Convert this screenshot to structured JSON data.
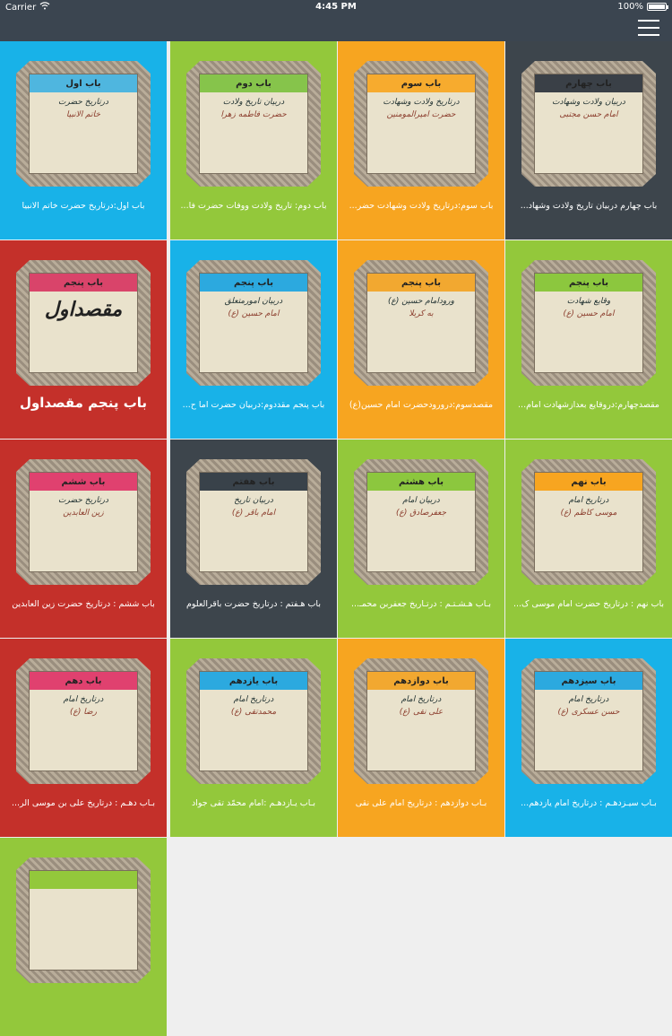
{
  "status": {
    "carrier": "Carrier",
    "time": "4:45 PM",
    "battery": "100%"
  },
  "colors": {
    "blue": "#18b2e8",
    "green": "#93c83b",
    "orange": "#f7a520",
    "dark": "#3d454c",
    "red": "#c4302a"
  },
  "tiles": [
    {
      "bg": "#18b2e8",
      "banner": "باب اول",
      "banner_color": "#4fb6df",
      "line1": "درتاریخ حضرت",
      "line2": "خاتم الانبیا",
      "caption": "باب اول:درتاریخ حضرت خاتم الانبیا"
    },
    {
      "bg": "#93c83b",
      "banner": "باب دوم",
      "banner_color": "#86c44b",
      "line1": "دربیان تاریخ ولادت",
      "line2": "حضرت فاطمه زهرا",
      "caption": "باب دوم: تاریخ ولادت ووفات حضرت فا..."
    },
    {
      "bg": "#f7a520",
      "banner": "باب سوم",
      "banner_color": "#f7ab2e",
      "line1": "درتاریخ ولادت وشهادت",
      "line2": "حضرت امیرالمومنین",
      "caption": "باب سوم:درتاریخ ولادت وشهادت حضر..."
    },
    {
      "bg": "#3d454c",
      "banner": "باب چهارم",
      "banner_color": "#3a4047",
      "line1": "دربیان ولادت وشهادت",
      "line2": "امام حسن مجتبی",
      "caption": "باب چهارم دربیان تاریخ ولادت وشهاد..."
    },
    {
      "bg": "#c4302a",
      "banner": "باب پنجم",
      "banner_color": "#d9446a",
      "line1": "مقصداول",
      "line2": "",
      "caption": "باب پنجم مقصداول",
      "big": true
    },
    {
      "bg": "#18b2e8",
      "banner": "باب پنجم",
      "banner_color": "#2ca9df",
      "line1": "دربیان امورمتعلق",
      "line2": "امام حسین (ع)",
      "caption": "باب پنجم مقددوم:دربیان حضرت اما ح..."
    },
    {
      "bg": "#f7a520",
      "banner": "باب پنجم",
      "banner_color": "#f2a830",
      "line1": "ورودامام حسین (ع)",
      "line2": "به کربلا",
      "caption": "مقصدسوم:درورودحضرت امام حسین(ع)"
    },
    {
      "bg": "#93c83b",
      "banner": "باب پنجم",
      "banner_color": "#8cc73e",
      "line1": "وقایع شهادت",
      "line2": "امام حسین (ع)",
      "caption": "مقصدچهارم:دروقایع بعدازشهادت امام..."
    },
    {
      "bg": "#c4302a",
      "banner": "باب ششم",
      "banner_color": "#e0416f",
      "line1": "درتاریخ حضرت",
      "line2": "زین العابدین",
      "caption": "باب ششم : درتاریخ حضرت زین العابدین"
    },
    {
      "bg": "#3d454c",
      "banner": "باب هفتم",
      "banner_color": "#39424a",
      "line1": "دربیان تاریخ",
      "line2": "امام باقر (ع)",
      "caption": "باب هـفتم : درتاریخ حضرت باقرالعلوم"
    },
    {
      "bg": "#93c83b",
      "banner": "باب هشتم",
      "banner_color": "#8cc73e",
      "line1": "دربیان امام",
      "line2": "جعفرصادق (ع)",
      "caption": "بـاب هـشـتـم : درتـاریخ جعفربن محمـ..."
    },
    {
      "bg": "#93c83b",
      "banner": "باب نهم",
      "banner_color": "#f7a520",
      "line1": "درتاریخ امام",
      "line2": "موسی کاظم (ع)",
      "caption": "باب نهم : درتاریخ حضرت امام موسی ک..."
    },
    {
      "bg": "#c4302a",
      "banner": "باب دهم",
      "banner_color": "#e0416f",
      "line1": "درتاریخ امام",
      "line2": "رضا (ع)",
      "caption": "بـاب دهـم : درتاریخ علی بن موسی الر..."
    },
    {
      "bg": "#93c83b",
      "banner": "باب یازدهم",
      "banner_color": "#2ca9df",
      "line1": "درتاریخ امام",
      "line2": "محمدتقی (ع)",
      "caption": "بـاب یـازدهـم :امام محمّد تقی جواد"
    },
    {
      "bg": "#f7a520",
      "banner": "باب دوازدهم",
      "banner_color": "#f2a830",
      "line1": "درتاریخ امام",
      "line2": "علی نقی (ع)",
      "caption": "بـاب دوازدهم : درتاریخ امام علی نقی"
    },
    {
      "bg": "#18b2e8",
      "banner": "باب سیزدهم",
      "banner_color": "#2ca9df",
      "line1": "درتاریخ امام",
      "line2": "حسن عسکری (ع)",
      "caption": "بـاب سیـزدهـم : درتاریخ امام یازدهم..."
    },
    {
      "bg": "#93c83b",
      "banner": "",
      "banner_color": "#93c83b",
      "line1": "",
      "line2": "",
      "caption": ""
    }
  ]
}
